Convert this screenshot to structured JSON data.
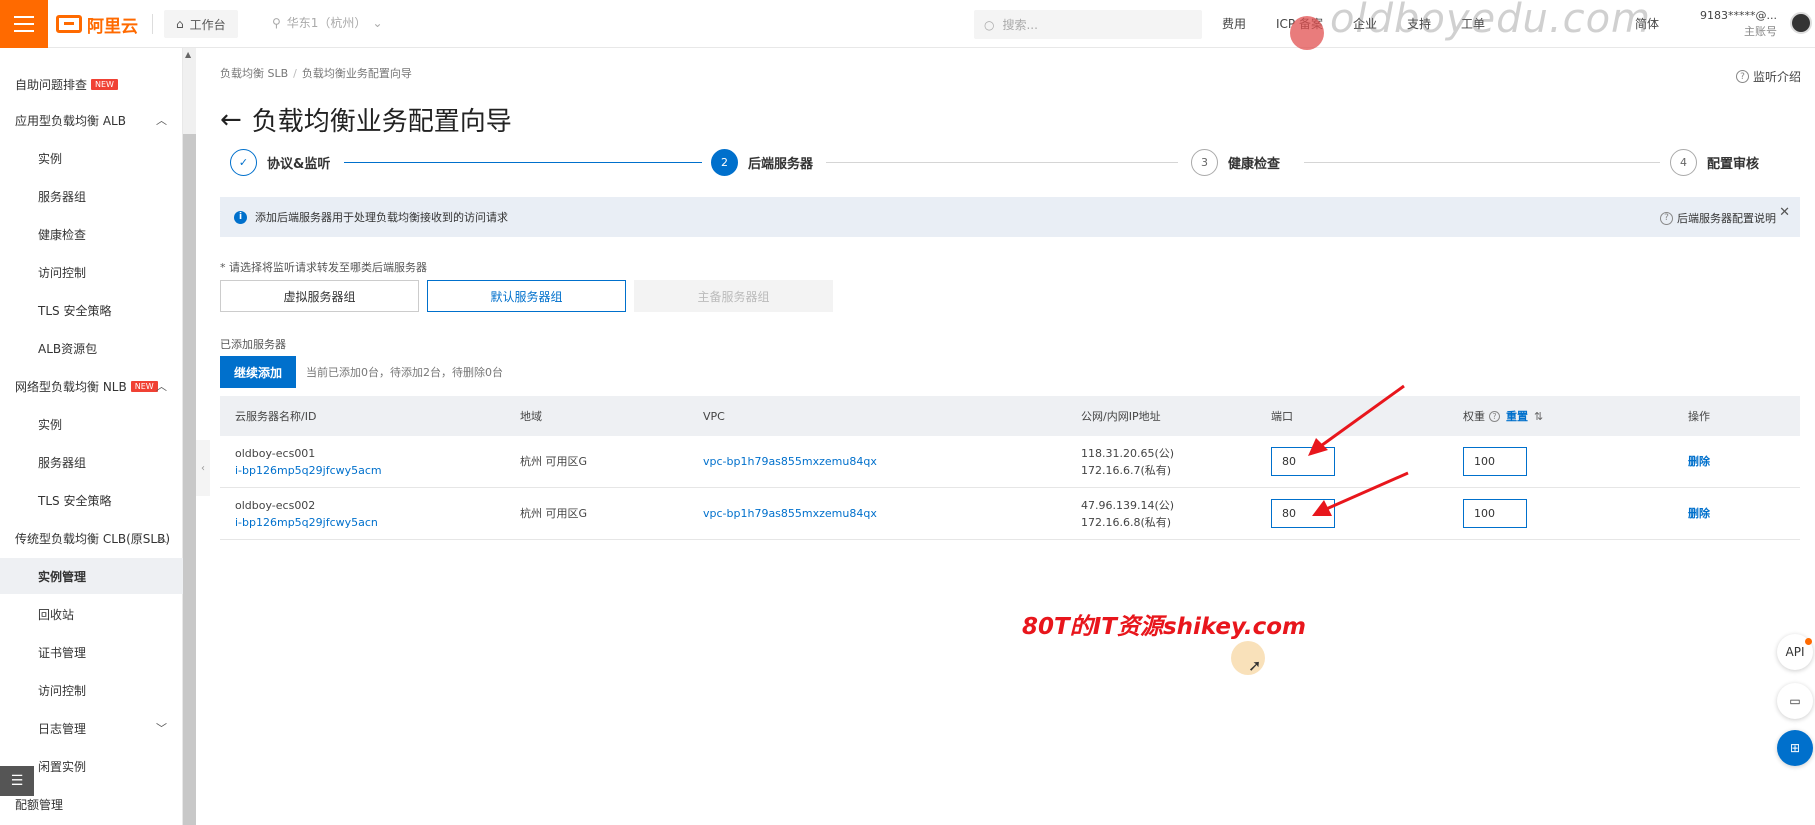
{
  "topbar": {
    "logo": "阿里云",
    "workbench": "工作台",
    "region": "华东1（杭州）",
    "search_placeholder": "搜索...",
    "links": [
      "费用",
      "ICP 备案",
      "企业",
      "支持",
      "工单"
    ],
    "lang": "简体",
    "user": "9183*****@...",
    "account_type": "主账号",
    "watermark": "oldboyedu.com"
  },
  "sidebar": {
    "items": [
      {
        "label": "自助问题排查",
        "badge": "NEW"
      },
      {
        "label": "应用型负载均衡 ALB"
      },
      {
        "label": "实例"
      },
      {
        "label": "服务器组"
      },
      {
        "label": "健康检查"
      },
      {
        "label": "访问控制"
      },
      {
        "label": "TLS 安全策略"
      },
      {
        "label": "ALB资源包"
      },
      {
        "label": "网络型负载均衡 NLB",
        "badge": "NEW"
      },
      {
        "label": "实例"
      },
      {
        "label": "服务器组"
      },
      {
        "label": "TLS 安全策略"
      },
      {
        "label": "传统型负载均衡 CLB(原SLB)"
      },
      {
        "label": "实例管理"
      },
      {
        "label": "回收站"
      },
      {
        "label": "证书管理"
      },
      {
        "label": "访问控制"
      },
      {
        "label": "日志管理"
      },
      {
        "label": "闲置实例"
      },
      {
        "label": "配额管理"
      }
    ]
  },
  "breadcrumb": {
    "root": "负载均衡 SLB",
    "current": "负载均衡业务配置向导"
  },
  "monitor_intro": "监听介绍",
  "page_title": "负载均衡业务配置向导",
  "steps": [
    {
      "num": "✓",
      "label": "协议&监听"
    },
    {
      "num": "2",
      "label": "后端服务器"
    },
    {
      "num": "3",
      "label": "健康检查"
    },
    {
      "num": "4",
      "label": "配置审核"
    }
  ],
  "info": {
    "text": "添加后端服务器用于处理负载均衡接收到的访问请求",
    "help_link": "后端服务器配置说明"
  },
  "select_hint": "* 请选择将监听请求转发至哪类后端服务器",
  "group_tabs": [
    "虚拟服务器组",
    "默认服务器组",
    "主备服务器组"
  ],
  "added_label": "已添加服务器",
  "continue_button": "继续添加",
  "add_status": "当前已添加0台，待添加2台，待删除0台",
  "table": {
    "headers": {
      "name": "云服务器名称/ID",
      "region": "地域",
      "vpc": "VPC",
      "ip": "公网/内网IP地址",
      "port": "端口",
      "weight": "权重",
      "reset": "重置",
      "action": "操作"
    },
    "rows": [
      {
        "name": "oldboy-ecs001",
        "id": "i-bp126mp5q29jfcwy5acm",
        "region": "杭州 可用区G",
        "vpc": "vpc-bp1h79as855mxzemu84qx",
        "public_ip": "118.31.20.65(公)",
        "private_ip": "172.16.6.7(私有)",
        "port": "80",
        "weight": "100",
        "action": "删除"
      },
      {
        "name": "oldboy-ecs002",
        "id": "i-bp126mp5q29jfcwy5acn",
        "region": "杭州 可用区G",
        "vpc": "vpc-bp1h79as855mxzemu84qx",
        "public_ip": "47.96.139.14(公)",
        "private_ip": "172.16.6.8(私有)",
        "port": "80",
        "weight": "100",
        "action": "删除"
      }
    ]
  },
  "promo": "80T的IT资源shikey.com",
  "float_buttons": [
    "API",
    "chat",
    "apps"
  ],
  "colors": {
    "brand": "#ff6a00",
    "primary": "#0070cc",
    "annotation": "#e8161c"
  }
}
